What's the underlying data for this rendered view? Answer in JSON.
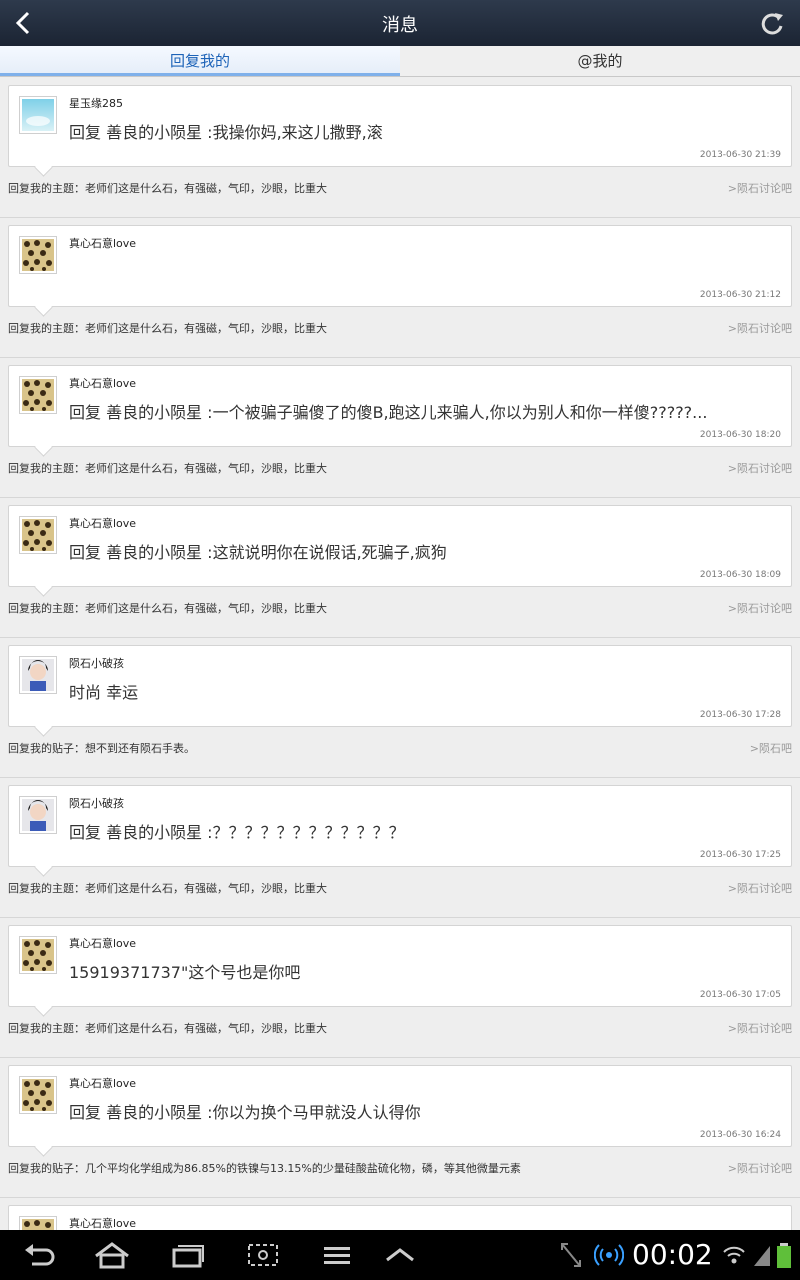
{
  "header": {
    "title": "消息"
  },
  "tabs": [
    {
      "label": "回复我的"
    },
    {
      "label": "@我的"
    }
  ],
  "messages": [
    {
      "user": "星玉缘285",
      "avatar": "sky",
      "content": "回复 善良的小陨星 :我操你妈,来这儿撒野,滚",
      "time": "2013-06-30 21:39",
      "context": "回复我的主题：老师们这是什么石，有强磁，气印，沙眼，比重大",
      "forum": ">陨石讨论吧"
    },
    {
      "user": "真心石意love",
      "avatar": "leopard",
      "content": "",
      "time": "2013-06-30 21:12",
      "context": "回复我的主题：老师们这是什么石，有强磁，气印，沙眼，比重大",
      "forum": ">陨石讨论吧"
    },
    {
      "user": "真心石意love",
      "avatar": "leopard",
      "content": "回复 善良的小陨星 :一个被骗子骗傻了的傻B,跑这儿来骗人,你以为别人和你一样傻?????...",
      "time": "2013-06-30 18:20",
      "context": "回复我的主题：老师们这是什么石，有强磁，气印，沙眼，比重大",
      "forum": ">陨石讨论吧"
    },
    {
      "user": "真心石意love",
      "avatar": "leopard",
      "content": "回复 善良的小陨星 :这就说明你在说假话,死骗子,疯狗",
      "time": "2013-06-30 18:09",
      "context": "回复我的主题：老师们这是什么石，有强磁，气印，沙眼，比重大",
      "forum": ">陨石讨论吧"
    },
    {
      "user": "陨石小破孩",
      "avatar": "kid",
      "content": "时尚 幸运",
      "time": "2013-06-30 17:28",
      "context": "回复我的贴子：想不到还有陨石手表。",
      "forum": ">陨石吧"
    },
    {
      "user": "陨石小破孩",
      "avatar": "kid",
      "content": "回复 善良的小陨星 :？？？？？？？？？？？？",
      "time": "2013-06-30 17:25",
      "context": "回复我的主题：老师们这是什么石，有强磁，气印，沙眼，比重大",
      "forum": ">陨石讨论吧"
    },
    {
      "user": "真心石意love",
      "avatar": "leopard",
      "content": "15919371737\"这个号也是你吧",
      "time": "2013-06-30 17:05",
      "context": "回复我的主题：老师们这是什么石，有强磁，气印，沙眼，比重大",
      "forum": ">陨石讨论吧"
    },
    {
      "user": "真心石意love",
      "avatar": "leopard",
      "content": "回复 善良的小陨星 :你以为换个马甲就没人认得你",
      "time": "2013-06-30 16:24",
      "context": "回复我的贴子：几个平均化学组成为86.85%的铁镍与13.15%的少量硅酸盐硫化物，磷，等其他微量元素",
      "forum": ">陨石讨论吧"
    },
    {
      "user": "真心石意love",
      "avatar": "leopard",
      "content": "",
      "time": "",
      "context": "",
      "forum": ""
    }
  ],
  "statusbar": {
    "clock": "00:02"
  }
}
